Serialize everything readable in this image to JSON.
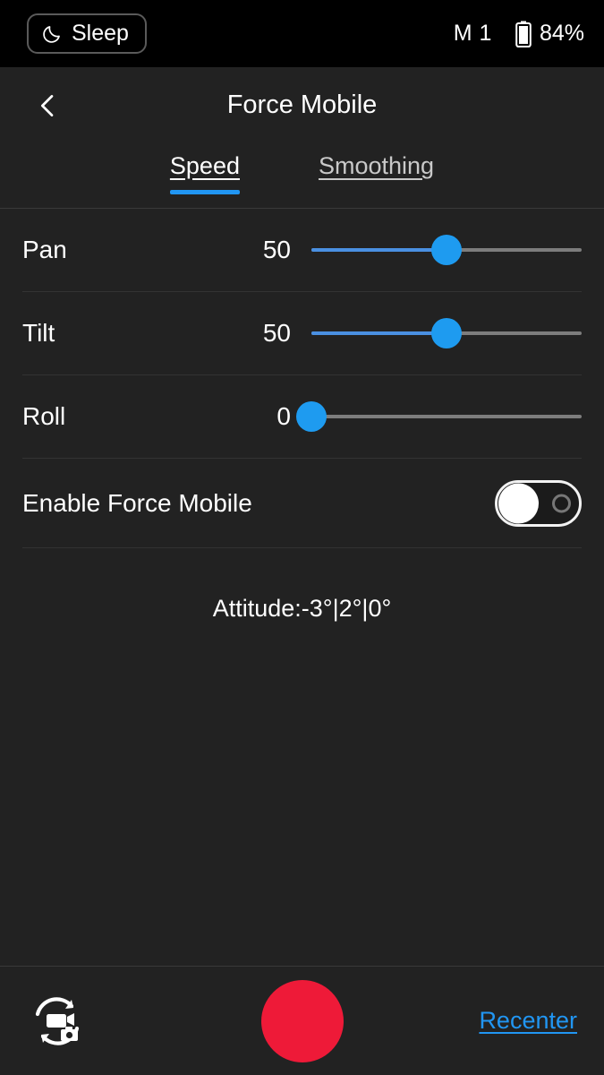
{
  "statusbar": {
    "sleep_label": "Sleep",
    "moon_icon": "moon-icon",
    "mode_text": "M 1",
    "battery_icon": "battery-icon",
    "battery_percent": "84%"
  },
  "header": {
    "back_icon": "chevron-left-icon",
    "title": "Force Mobile"
  },
  "tabs": [
    {
      "label": "Speed",
      "active": true
    },
    {
      "label": "Smoothing",
      "active": false
    }
  ],
  "settings": {
    "rows": [
      {
        "label": "Pan",
        "value": "50",
        "percent": 50
      },
      {
        "label": "Tilt",
        "value": "50",
        "percent": 50
      },
      {
        "label": "Roll",
        "value": "0",
        "percent": 0
      }
    ],
    "toggle": {
      "label": "Enable Force Mobile",
      "state": "off"
    },
    "attitude_text": "Attitude:-3°|2°|0°"
  },
  "bottombar": {
    "mode_switch_icon": "camera-mode-switch-icon",
    "record_button": "record-button",
    "recenter_label": "Recenter"
  },
  "colors": {
    "accent_blue": "#2196f3",
    "slider_thumb": "#1e9bf0",
    "slider_fill": "#4a90e2",
    "record_red": "#ee1a38",
    "background": "#222222",
    "statusbar_background": "#000000"
  }
}
